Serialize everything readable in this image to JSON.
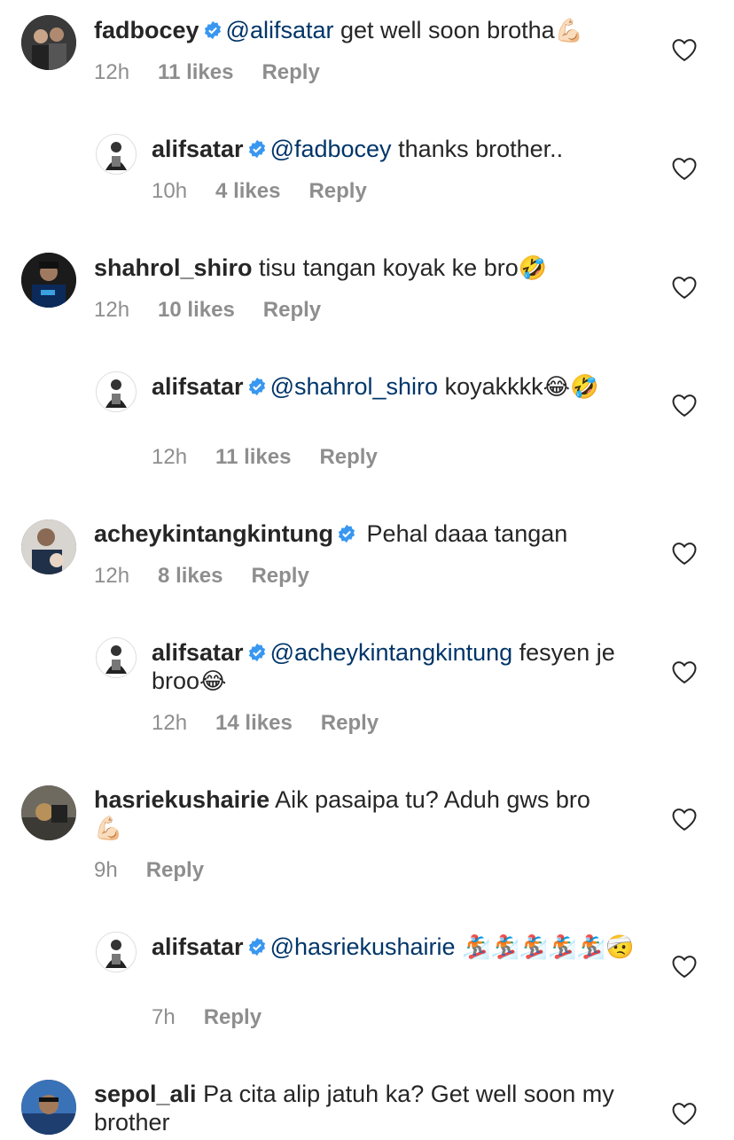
{
  "comments": [
    {
      "username": "fadbocey",
      "verified": true,
      "mention": "@alifsatar",
      "text": " get well soon brotha",
      "emoji": "💪🏻",
      "time": "12h",
      "likes": "11 likes",
      "reply": "Reply"
    },
    {
      "username": "alifsatar",
      "verified": true,
      "mention": "@fadbocey",
      "text": " thanks brother..",
      "emoji": "",
      "time": "10h",
      "likes": "4 likes",
      "reply": "Reply"
    },
    {
      "username": "shahrol_shiro",
      "verified": false,
      "mention": "",
      "text": " tisu tangan koyak ke bro",
      "emoji": "🤣",
      "time": "12h",
      "likes": "10 likes",
      "reply": "Reply"
    },
    {
      "username": "alifsatar",
      "verified": true,
      "mention": "@shahrol_shiro",
      "text": " koyakkkk",
      "emoji": "😂🤣",
      "time": "12h",
      "likes": "11 likes",
      "reply": "Reply"
    },
    {
      "username": "acheykintangkintung",
      "verified": true,
      "mention": "",
      "text": " Pehal daaa tangan",
      "emoji": "",
      "time": "12h",
      "likes": "8 likes",
      "reply": "Reply"
    },
    {
      "username": "alifsatar",
      "verified": true,
      "mention": "@acheykintangkintung",
      "text": " fesyen je broo",
      "emoji": "😂",
      "time": "12h",
      "likes": "14 likes",
      "reply": "Reply"
    },
    {
      "username": "hasriekushairie",
      "verified": false,
      "mention": "",
      "text": " Aik pasaipa tu? Aduh gws bro",
      "emoji": "💪🏻",
      "time": "9h",
      "likes": "",
      "reply": "Reply"
    },
    {
      "username": "alifsatar",
      "verified": true,
      "mention": "@hasriekushairie",
      "text": " ",
      "emoji": "🏂🏂🏂🏂🏂🤕",
      "time": "7h",
      "likes": "",
      "reply": "Reply"
    },
    {
      "username": "sepol_ali",
      "verified": false,
      "mention": "",
      "text": " Pa cita alip jatuh ka? Get well soon my brother",
      "emoji": "",
      "time": "",
      "likes": "",
      "reply": ""
    }
  ],
  "colors": {
    "mention": "#003569",
    "verified": "#3897f0",
    "meta": "#8e8e8e"
  },
  "icons": {
    "like": "heart-outline-icon",
    "verified": "verified-badge-icon"
  }
}
